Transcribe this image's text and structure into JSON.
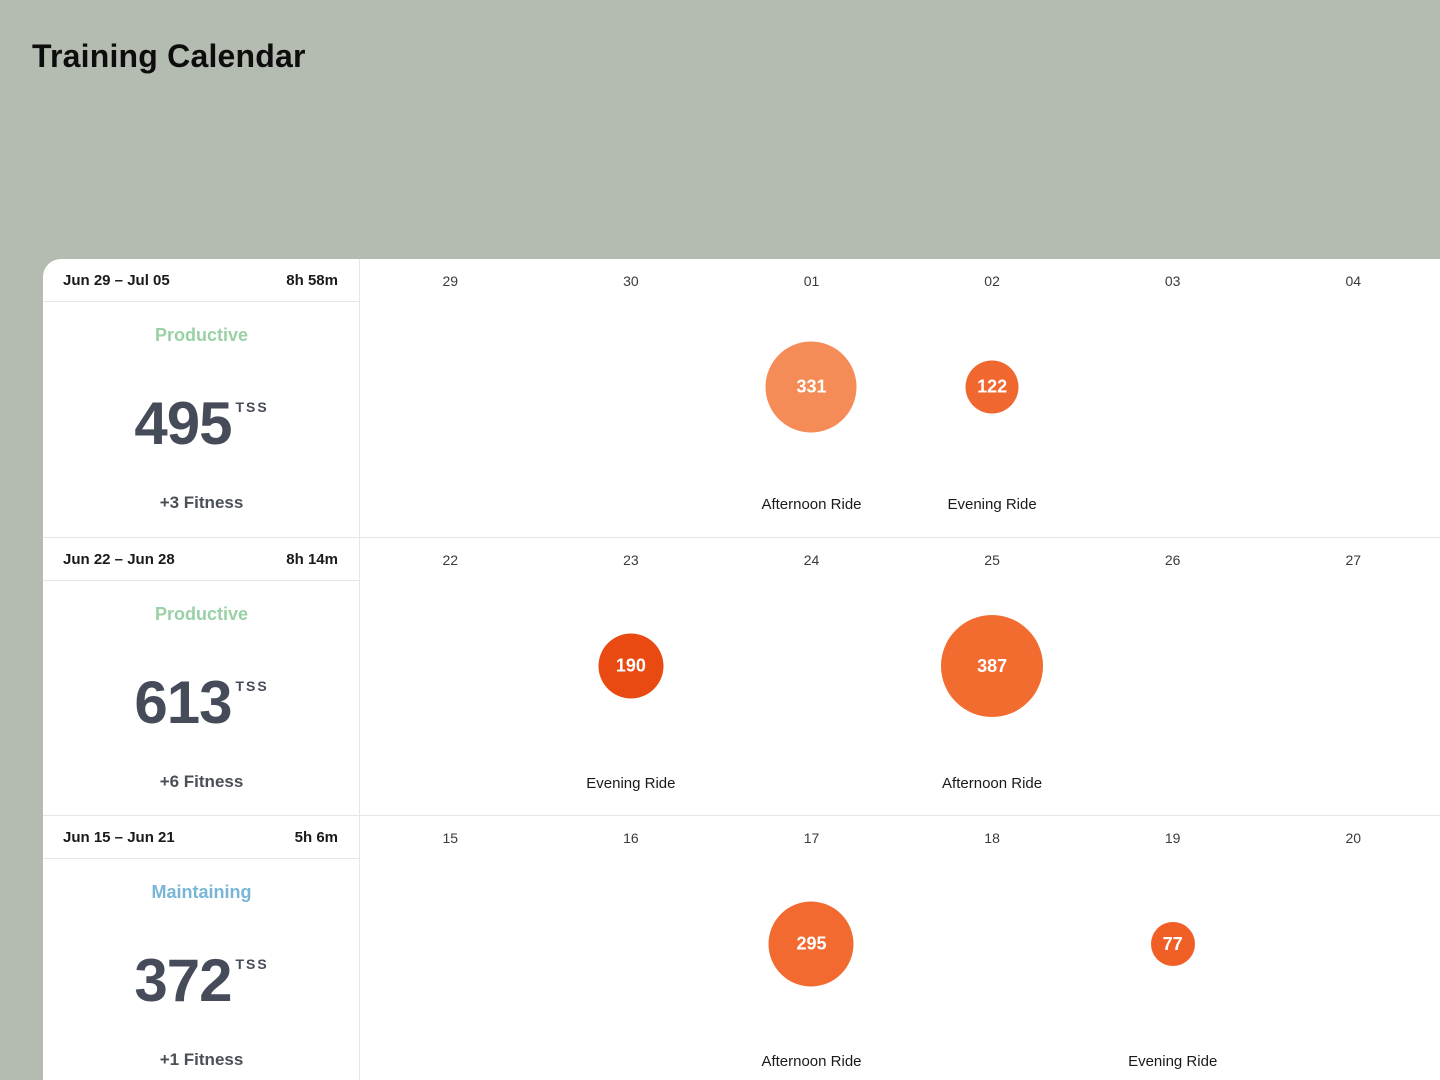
{
  "page": {
    "title": "Training Calendar"
  },
  "weeks": [
    {
      "range": "Jun 29 – Jul 05",
      "duration": "8h 58m",
      "status": "Productive",
      "status_kind": "productive",
      "tss": "495",
      "tss_unit": "TSS",
      "fitness": "+3 Fitness",
      "days": [
        {
          "num": "29"
        },
        {
          "num": "30"
        },
        {
          "num": "01",
          "activity": {
            "tss": "331",
            "name": "Afternoon Ride",
            "color": "#f58b57"
          }
        },
        {
          "num": "02",
          "activity": {
            "tss": "122",
            "name": "Evening Ride",
            "color": "#f0672f"
          }
        },
        {
          "num": "03"
        },
        {
          "num": "04"
        }
      ]
    },
    {
      "range": "Jun 22 – Jun 28",
      "duration": "8h 14m",
      "status": "Productive",
      "status_kind": "productive",
      "tss": "613",
      "tss_unit": "TSS",
      "fitness": "+6 Fitness",
      "days": [
        {
          "num": "22"
        },
        {
          "num": "23",
          "activity": {
            "tss": "190",
            "name": "Evening Ride",
            "color": "#e84a12"
          }
        },
        {
          "num": "24"
        },
        {
          "num": "25",
          "activity": {
            "tss": "387",
            "name": "Afternoon Ride",
            "color": "#f26b2f"
          }
        },
        {
          "num": "26"
        },
        {
          "num": "27"
        }
      ]
    },
    {
      "range": "Jun 15 – Jun 21",
      "duration": "5h 6m",
      "status": "Maintaining",
      "status_kind": "maintaining",
      "tss": "372",
      "tss_unit": "TSS",
      "fitness": "+1 Fitness",
      "days": [
        {
          "num": "15"
        },
        {
          "num": "16"
        },
        {
          "num": "17",
          "activity": {
            "tss": "295",
            "name": "Afternoon Ride",
            "color": "#f26a30"
          }
        },
        {
          "num": "18"
        },
        {
          "num": "19",
          "activity": {
            "tss": "77",
            "name": "Evening Ride",
            "color": "#ef5f26"
          }
        },
        {
          "num": "20"
        }
      ]
    }
  ]
}
